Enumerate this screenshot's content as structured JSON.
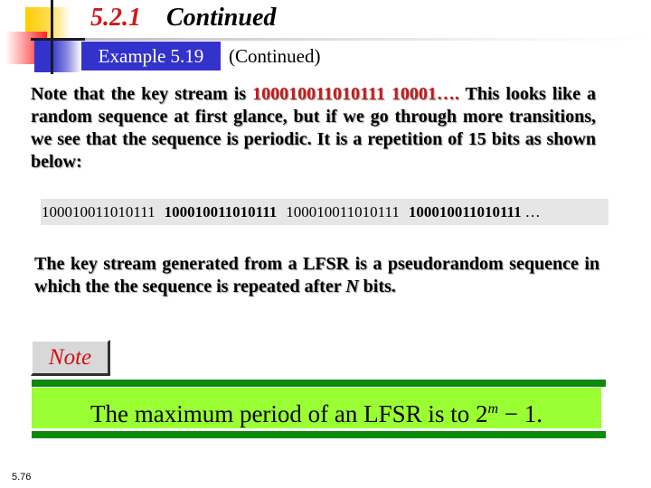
{
  "slide": {
    "section_number": "5.2.1",
    "section_title": "Continued",
    "example_label": "Example 5.19",
    "example_continued": "(Continued)",
    "paragraph1": {
      "before": "Note that the key stream is ",
      "highlight": "100010011010111 10001…. ",
      "after": "This looks like a random sequence at first glance, but if we go through more transitions, we see that the sequence is periodic. It is a repetition of 15 bits as shown below:"
    },
    "sequence": [
      {
        "bits": "100010011010111",
        "bold": false
      },
      {
        "bits": "100010011010111",
        "bold": true
      },
      {
        "bits": "100010011010111",
        "bold": false
      },
      {
        "bits": "100010011010111",
        "bold": true
      }
    ],
    "sequence_ellipsis": "…",
    "paragraph2": {
      "before": "The key stream generated from a LFSR is a pseudorandom sequence in which the the sequence is repeated after ",
      "variable": "N",
      "after": " bits."
    },
    "note_label": "Note",
    "note_box": {
      "before": "The maximum period of an LFSR is to 2",
      "exponent": "m",
      "after": " − 1."
    },
    "page_number": "5.76"
  },
  "colors": {
    "section_number": "#d01818",
    "example_badge_bg": "#3333cc",
    "highlight_red": "#c81818",
    "sequence_bg": "#e6e6e6",
    "note_text": "#cc1111",
    "note_bar_dark_green": "#0b8a0b",
    "note_box_light_green": "#99ff33"
  }
}
